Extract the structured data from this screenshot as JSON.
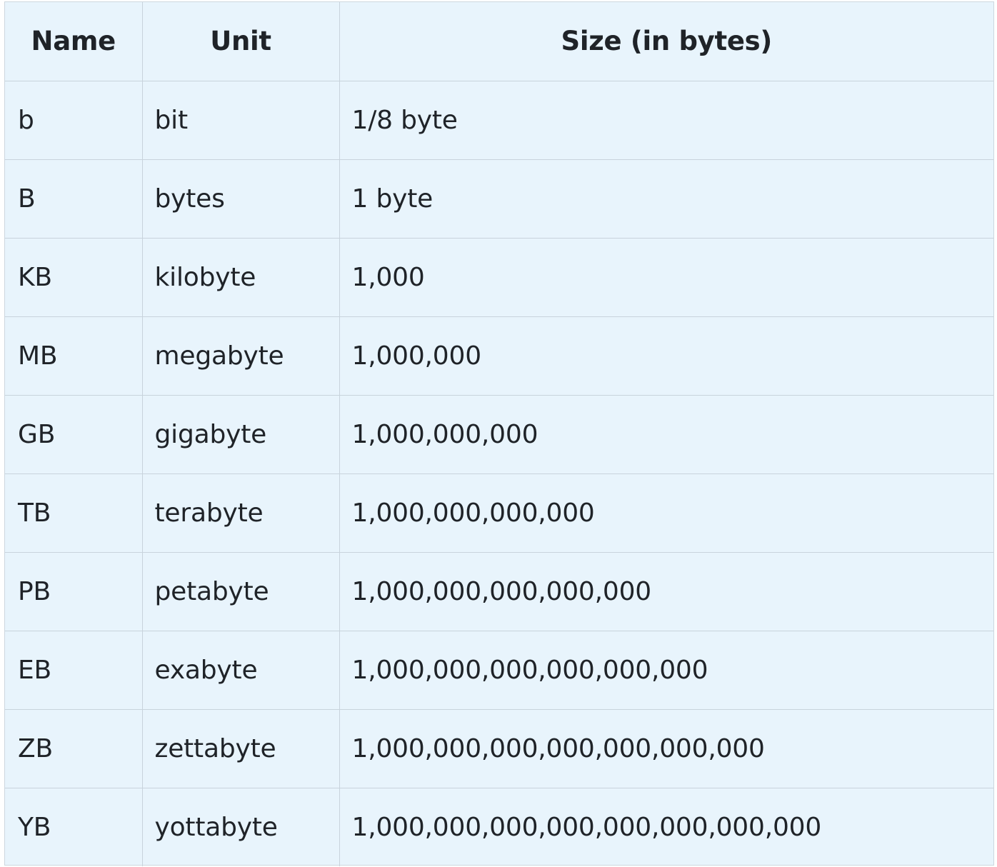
{
  "table": {
    "headers": [
      "Name",
      "Unit",
      "Size (in bytes)"
    ],
    "rows": [
      [
        "b",
        "bit",
        "1/8 byte"
      ],
      [
        "B",
        "bytes",
        "1 byte"
      ],
      [
        "KB",
        "kilobyte",
        "1,000"
      ],
      [
        "MB",
        "megabyte",
        "1,000,000"
      ],
      [
        "GB",
        "gigabyte",
        "1,000,000,000"
      ],
      [
        "TB",
        "terabyte",
        "1,000,000,000,000"
      ],
      [
        "PB",
        "petabyte",
        "1,000,000,000,000,000"
      ],
      [
        "EB",
        "exabyte",
        "1,000,000,000,000,000,000"
      ],
      [
        "ZB",
        "zettabyte",
        "1,000,000,000,000,000,000,000"
      ],
      [
        "YB",
        "yottabyte",
        "1,000,000,000,000,000,000,000,000"
      ]
    ]
  },
  "colors": {
    "background": "#e8f4fc",
    "border": "#c8d3dc",
    "text": "#1f2328"
  }
}
